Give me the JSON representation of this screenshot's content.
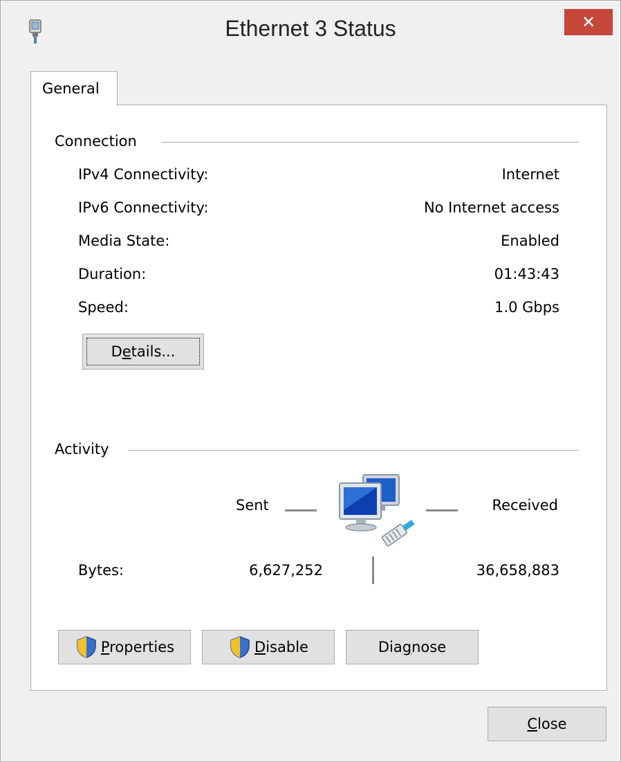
{
  "window": {
    "title": "Ethernet 3 Status",
    "close_glyph": "✕"
  },
  "tabs": [
    {
      "label": "General"
    }
  ],
  "connection": {
    "group_label": "Connection",
    "rows": [
      {
        "label": "IPv4 Connectivity:",
        "value": "Internet"
      },
      {
        "label": "IPv6 Connectivity:",
        "value": "No Internet access"
      },
      {
        "label": "Media State:",
        "value": "Enabled"
      },
      {
        "label": "Duration:",
        "value": "01:43:43"
      },
      {
        "label": "Speed:",
        "value": "1.0 Gbps"
      }
    ],
    "details_button": {
      "pre": "D",
      "mnemonic": "e",
      "post": "tails..."
    }
  },
  "activity": {
    "group_label": "Activity",
    "sent_label": "Sent",
    "received_label": "Received",
    "bytes_label": "Bytes:",
    "bytes_sent": "6,627,252",
    "bytes_received": "36,658,883"
  },
  "buttons": {
    "properties": {
      "mnemonic": "P",
      "rest": "roperties"
    },
    "disable": {
      "mnemonic": "D",
      "rest": "isable"
    },
    "diagnose": {
      "pre": "Dia",
      "mnemonic": "g",
      "post": "nose"
    },
    "close": {
      "mnemonic": "C",
      "rest": "lose"
    }
  },
  "icons": {
    "title": "network-adapter-icon",
    "activity": "network-computers-icon",
    "uac": "uac-shield-icon"
  },
  "colors": {
    "close_button": "#c7463a",
    "panel_border": "#adadad",
    "button_face": "#e1e1e1",
    "window_bg": "#f0f0f0"
  }
}
